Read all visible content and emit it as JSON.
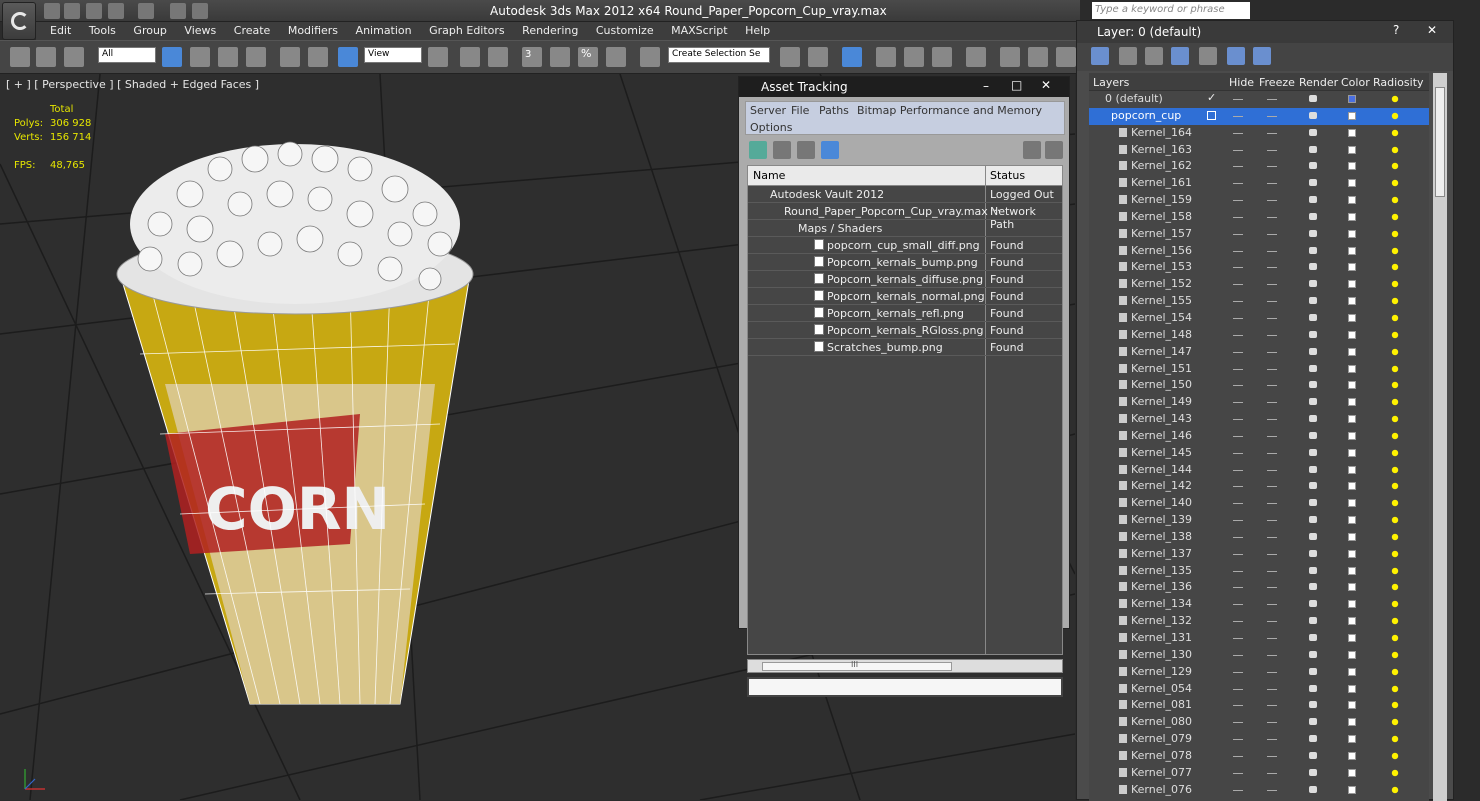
{
  "app": {
    "title": "Autodesk 3ds Max  2012 x64      Round_Paper_Popcorn_Cup_vray.max",
    "search_placeholder": "Type a keyword or phrase"
  },
  "menu": [
    "Edit",
    "Tools",
    "Group",
    "Views",
    "Create",
    "Modifiers",
    "Animation",
    "Graph Editors",
    "Rendering",
    "Customize",
    "MAXScript",
    "Help"
  ],
  "toolbar": {
    "filter_value": "All",
    "view_value": "View",
    "selection_set_placeholder": "Create Selection Se",
    "snap_count": "3",
    "percent_snap": "%"
  },
  "viewport": {
    "label": "[ + ] [ Perspective ] [ Shaded + Edged Faces ]",
    "stats_header": "Total",
    "polys_label": "Polys:",
    "polys_value": "306 928",
    "verts_label": "Verts:",
    "verts_value": "156 714",
    "fps_label": "FPS:",
    "fps_value": "48,765",
    "cup_text": "CORN"
  },
  "asset_tracking": {
    "title": "Asset Tracking",
    "menu": [
      "Server",
      "File",
      "Paths",
      "Bitmap Performance and Memory",
      "Options"
    ],
    "col_name": "Name",
    "col_status": "Status",
    "rows": [
      {
        "name": "Autodesk Vault 2012",
        "status": "Logged Out ..."
      },
      {
        "name": "Round_Paper_Popcorn_Cup_vray.max",
        "status": "Network Path"
      },
      {
        "name": "Maps / Shaders",
        "status": ""
      },
      {
        "name": "popcorn_cup_small_diff.png",
        "status": "Found"
      },
      {
        "name": "Popcorn_kernals_bump.png",
        "status": "Found"
      },
      {
        "name": "Popcorn_kernals_diffuse.png",
        "status": "Found"
      },
      {
        "name": "Popcorn_kernals_normal.png",
        "status": "Found"
      },
      {
        "name": "Popcorn_kernals_refl.png",
        "status": "Found"
      },
      {
        "name": "Popcorn_kernals_RGloss.png",
        "status": "Found"
      },
      {
        "name": "Scratches_bump.png",
        "status": "Found"
      }
    ],
    "scroll_glyph": "III"
  },
  "layers": {
    "title": "Layer: 0 (default)",
    "headers": {
      "layers": "Layers",
      "hide": "Hide",
      "freeze": "Freeze",
      "render": "Render",
      "color": "Color",
      "radiosity": "Radiosity"
    },
    "default_layer": "0 (default)",
    "active_layer": "popcorn_cup",
    "items": [
      "Kernel_164",
      "Kernel_163",
      "Kernel_162",
      "Kernel_161",
      "Kernel_159",
      "Kernel_158",
      "Kernel_157",
      "Kernel_156",
      "Kernel_153",
      "Kernel_152",
      "Kernel_155",
      "Kernel_154",
      "Kernel_148",
      "Kernel_147",
      "Kernel_151",
      "Kernel_150",
      "Kernel_149",
      "Kernel_143",
      "Kernel_146",
      "Kernel_145",
      "Kernel_144",
      "Kernel_142",
      "Kernel_140",
      "Kernel_139",
      "Kernel_138",
      "Kernel_137",
      "Kernel_135",
      "Kernel_136",
      "Kernel_134",
      "Kernel_132",
      "Kernel_131",
      "Kernel_130",
      "Kernel_129",
      "Kernel_054",
      "Kernel_081",
      "Kernel_080",
      "Kernel_079",
      "Kernel_078",
      "Kernel_077",
      "Kernel_076"
    ]
  },
  "colors": {
    "active_layer": "#2f6fd6",
    "cup_yellow": "#d4b81a",
    "stats_yellow": "#e6e600"
  }
}
